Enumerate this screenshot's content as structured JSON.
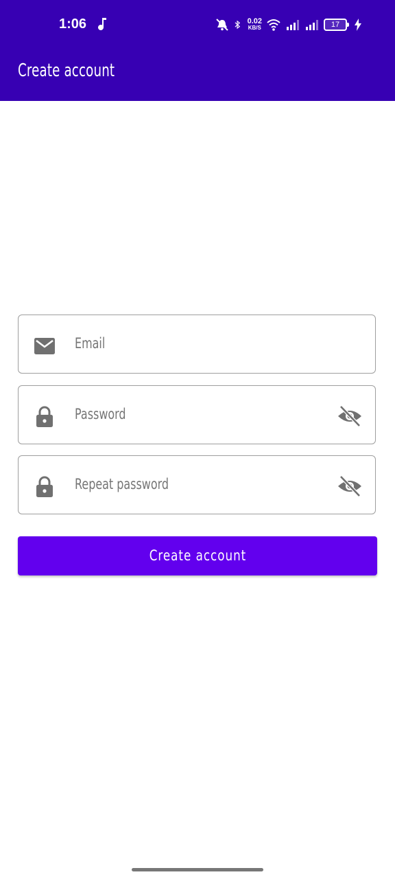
{
  "status_bar": {
    "time": "1:06",
    "net_speed_value": "0.02",
    "net_speed_unit": "KB/S",
    "battery_level": "17",
    "icons": [
      "music-note-icon",
      "mute-icon",
      "bluetooth-icon",
      "wifi-icon",
      "signal-icon",
      "signal-icon",
      "battery-icon",
      "charging-icon"
    ]
  },
  "app_bar": {
    "title": "Create account"
  },
  "form": {
    "email": {
      "placeholder": "Email",
      "icon": "email-icon"
    },
    "password": {
      "placeholder": "Password",
      "icon": "lock-icon",
      "toggle_icon": "visibility-off-icon"
    },
    "repeat_password": {
      "placeholder": "Repeat password",
      "icon": "lock-icon",
      "toggle_icon": "visibility-off-icon"
    },
    "submit_label": "Create account"
  },
  "colors": {
    "app_bar": "#3700b3",
    "button": "#6200ee",
    "icon": "#707070",
    "border": "#9e9e9e"
  }
}
